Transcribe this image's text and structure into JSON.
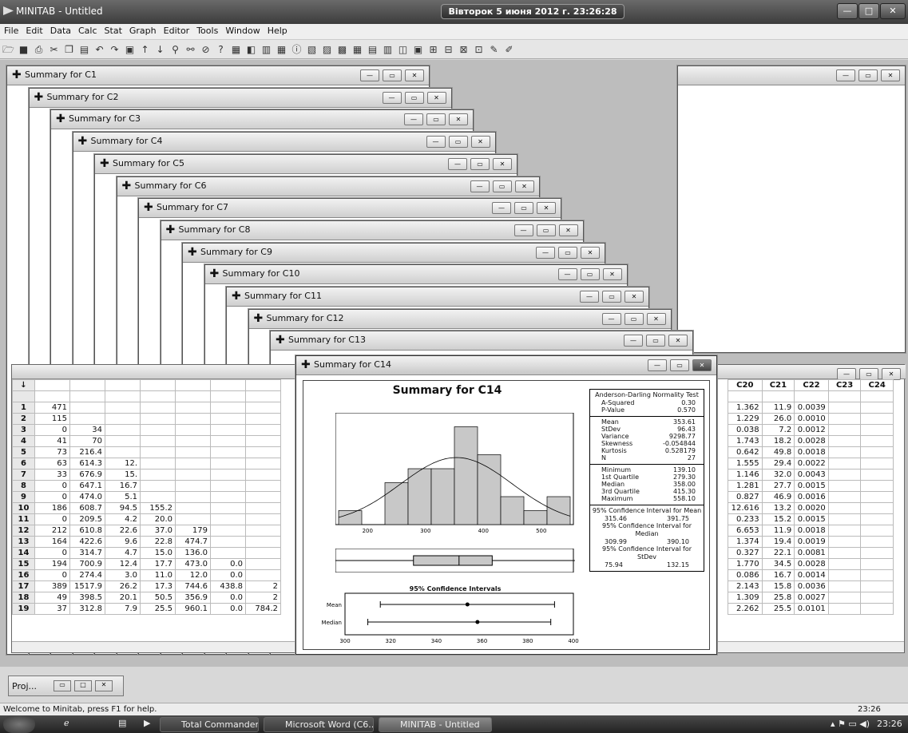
{
  "app": {
    "title": "MINITAB - Untitled",
    "clock": "Вівторок 5 июня 2012 г. 23:26:28"
  },
  "window_buttons": {
    "minimize": "—",
    "maximize": "□",
    "close": "✕"
  },
  "menu": [
    "File",
    "Edit",
    "Data",
    "Calc",
    "Stat",
    "Graph",
    "Editor",
    "Tools",
    "Window",
    "Help"
  ],
  "toolbar_icons": [
    "open-icon",
    "save-icon",
    "print-icon",
    "cut-icon",
    "copy-icon",
    "paste-icon",
    "undo-icon",
    "redo-icon",
    "session-icon",
    "up-icon",
    "down-icon",
    "find-icon",
    "replace-icon",
    "cancel-icon",
    "help-icon",
    "stat-guide-icon",
    "graph-icon"
  ],
  "summary_windows": [
    "Summary for C1",
    "Summary for C2",
    "Summary for C3",
    "Summary for C4",
    "Summary for C5",
    "Summary for C6",
    "Summary for C7",
    "Summary for C8",
    "Summary for C9",
    "Summary for C10",
    "Summary for C11",
    "Summary for C12",
    "Summary for C13"
  ],
  "front_window": {
    "caption": "Summary for C14",
    "chart_title": "Summary for C14",
    "ci_title": "95% Confidence Intervals",
    "ci_rows": [
      "Mean",
      "Median"
    ]
  },
  "chart_data": [
    {
      "type": "bar",
      "title": "Summary for C14",
      "x_ticks": [
        "200",
        "300",
        "400",
        "500"
      ],
      "bins": [
        150,
        190,
        230,
        270,
        310,
        350,
        390,
        430,
        470,
        510,
        550
      ],
      "values": [
        1,
        0,
        3,
        4,
        4,
        7,
        5,
        2,
        1,
        2
      ],
      "normal_curve": {
        "mean": 353.61,
        "stdev": 96.43
      }
    },
    {
      "type": "scatter",
      "title": "95% Confidence Intervals",
      "x_ticks": [
        "300",
        "320",
        "340",
        "360",
        "380",
        "400"
      ],
      "xlim": [
        300,
        400
      ],
      "series": [
        {
          "name": "Mean",
          "low": 315.46,
          "point": 353.61,
          "high": 391.75
        },
        {
          "name": "Median",
          "low": 309.99,
          "point": 358.0,
          "high": 390.1
        }
      ]
    }
  ],
  "stats": {
    "ad_title": "Anderson-Darling Normality Test",
    "ad": [
      [
        "A-Squared",
        "0.30"
      ],
      [
        "P-Value",
        "0.570"
      ]
    ],
    "moments": [
      [
        "Mean",
        "353.61"
      ],
      [
        "StDev",
        "96.43"
      ],
      [
        "Variance",
        "9298.77"
      ],
      [
        "Skewness",
        "-0.054844"
      ],
      [
        "Kurtosis",
        "0.528179"
      ],
      [
        "N",
        "27"
      ]
    ],
    "quantiles": [
      [
        "Minimum",
        "139.10"
      ],
      [
        "1st Quartile",
        "279.30"
      ],
      [
        "Median",
        "358.00"
      ],
      [
        "3rd Quartile",
        "415.30"
      ],
      [
        "Maximum",
        "558.10"
      ]
    ],
    "ci_mean_title": "95% Confidence Interval for Mean",
    "ci_mean": [
      "315.46",
      "391.75"
    ],
    "ci_median_title": "95% Confidence Interval for Median",
    "ci_median": [
      "309.99",
      "390.10"
    ],
    "ci_stdev_title": "95% Confidence Interval for StDev",
    "ci_stdev": [
      "75.94",
      "132.15"
    ]
  },
  "worksheet": {
    "right_headers": [
      "C20",
      "C21",
      "C22",
      "C23",
      "C24"
    ],
    "rows": [
      {
        "n": "1",
        "left": [
          "471",
          "",
          "",
          "",
          "",
          "",
          ""
        ],
        "right": [
          "1.362",
          "11.9",
          "0.0039"
        ]
      },
      {
        "n": "2",
        "left": [
          "115",
          "",
          "",
          "",
          "",
          "",
          ""
        ],
        "right": [
          "1.229",
          "26.0",
          "0.0010"
        ]
      },
      {
        "n": "3",
        "left": [
          "0",
          "34",
          "",
          "",
          "",
          "",
          ""
        ],
        "right": [
          "0.038",
          "7.2",
          "0.0012"
        ]
      },
      {
        "n": "4",
        "left": [
          "41",
          "70",
          "",
          "",
          "",
          "",
          ""
        ],
        "right": [
          "1.743",
          "18.2",
          "0.0028"
        ]
      },
      {
        "n": "5",
        "left": [
          "73",
          "216.4",
          "",
          "",
          "",
          "",
          ""
        ],
        "right": [
          "0.642",
          "49.8",
          "0.0018"
        ]
      },
      {
        "n": "6",
        "left": [
          "63",
          "614.3",
          "12.",
          "",
          "",
          "",
          ""
        ],
        "right": [
          "1.555",
          "29.4",
          "0.0022"
        ]
      },
      {
        "n": "7",
        "left": [
          "33",
          "676.9",
          "15.",
          "",
          "",
          "",
          ""
        ],
        "right": [
          "1.146",
          "32.0",
          "0.0043"
        ]
      },
      {
        "n": "8",
        "left": [
          "0",
          "647.1",
          "16.7",
          "",
          "",
          "",
          ""
        ],
        "right": [
          "1.281",
          "27.7",
          "0.0015"
        ]
      },
      {
        "n": "9",
        "left": [
          "0",
          "474.0",
          "5.1",
          "",
          "",
          "",
          ""
        ],
        "right": [
          "0.827",
          "46.9",
          "0.0016"
        ]
      },
      {
        "n": "10",
        "left": [
          "186",
          "608.7",
          "94.5",
          "155.2",
          "",
          "",
          ""
        ],
        "right": [
          "12.616",
          "13.2",
          "0.0020"
        ]
      },
      {
        "n": "11",
        "left": [
          "0",
          "209.5",
          "4.2",
          "20.0",
          "",
          "",
          ""
        ],
        "right": [
          "0.233",
          "15.2",
          "0.0015"
        ]
      },
      {
        "n": "12",
        "left": [
          "212",
          "610.8",
          "22.6",
          "37.0",
          "179",
          "",
          ""
        ],
        "right": [
          "6.653",
          "11.9",
          "0.0018"
        ]
      },
      {
        "n": "13",
        "left": [
          "164",
          "422.6",
          "9.6",
          "22.8",
          "474.7",
          "",
          ""
        ],
        "right": [
          "1.374",
          "19.4",
          "0.0019"
        ]
      },
      {
        "n": "14",
        "left": [
          "0",
          "314.7",
          "4.7",
          "15.0",
          "136.0",
          "",
          ""
        ],
        "right": [
          "0.327",
          "22.1",
          "0.0081"
        ]
      },
      {
        "n": "15",
        "left": [
          "194",
          "700.9",
          "12.4",
          "17.7",
          "473.0",
          "0.0",
          ""
        ],
        "right": [
          "1.770",
          "34.5",
          "0.0028"
        ]
      },
      {
        "n": "16",
        "left": [
          "0",
          "274.4",
          "3.0",
          "11.0",
          "12.0",
          "0.0",
          ""
        ],
        "right": [
          "0.086",
          "16.7",
          "0.0014"
        ]
      },
      {
        "n": "17",
        "left": [
          "389",
          "1517.9",
          "26.2",
          "17.3",
          "744.6",
          "438.8",
          "2"
        ],
        "right": [
          "2.143",
          "15.8",
          "0.0036"
        ]
      },
      {
        "n": "18",
        "left": [
          "49",
          "398.5",
          "20.1",
          "50.5",
          "356.9",
          "0.0",
          "2"
        ],
        "right": [
          "1.309",
          "25.8",
          "0.0027"
        ]
      },
      {
        "n": "19",
        "left": [
          "37",
          "312.8",
          "7.9",
          "25.5",
          "960.1",
          "0.0",
          "784.2"
        ],
        "right": [
          "2.262",
          "25.5",
          "0.0101"
        ]
      }
    ]
  },
  "project_tab": "Proj...",
  "status": {
    "message": "Welcome to Minitab, press F1 for help.",
    "time": "23:26"
  },
  "taskbar": {
    "items": [
      "Total Commander 8....",
      "Microsoft Word (C6...",
      "MINITAB - Untitled"
    ],
    "time": "23:26"
  }
}
